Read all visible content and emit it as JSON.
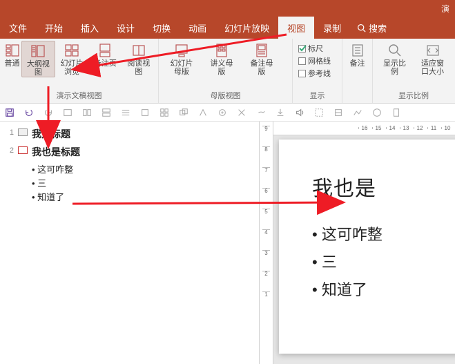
{
  "titlebar": {
    "right": "演"
  },
  "menu": {
    "items": [
      "文件",
      "开始",
      "插入",
      "设计",
      "切换",
      "动画",
      "幻灯片放映",
      "视图",
      "录制"
    ],
    "active_index": 7,
    "search_placeholder": "搜索"
  },
  "ribbon": {
    "group1": {
      "label": "演示文稿视图",
      "btns": [
        "普通",
        "大纲视图",
        "幻灯片浏览",
        "备注页",
        "阅读视图"
      ],
      "selected_index": 1
    },
    "group2": {
      "label": "母版视图",
      "btns": [
        "幻灯片母版",
        "讲义母版",
        "备注母版"
      ]
    },
    "group3": {
      "label": "显示",
      "chks": [
        "标尺",
        "网格线",
        "参考线"
      ],
      "checked": [
        true,
        false,
        false
      ]
    },
    "group4": {
      "btn": "备注"
    },
    "group5": {
      "label": "显示比例",
      "btns": [
        "显示比例",
        "适应窗口大小"
      ]
    }
  },
  "outline": {
    "items": [
      {
        "num": "1",
        "title": "我是标题",
        "subs": []
      },
      {
        "num": "2",
        "title": "我也是标题",
        "subs": [
          "这可咋整",
          "三",
          "知道了"
        ]
      }
    ]
  },
  "slide": {
    "title": "我也是",
    "bullets": [
      "这可咋整",
      "三",
      "知道了"
    ]
  },
  "ruler_h": [
    "16",
    "15",
    "14",
    "13",
    "12",
    "11",
    "10"
  ],
  "ruler_v": [
    "9",
    "8",
    "7",
    "6",
    "5",
    "4",
    "3",
    "2",
    "1"
  ]
}
